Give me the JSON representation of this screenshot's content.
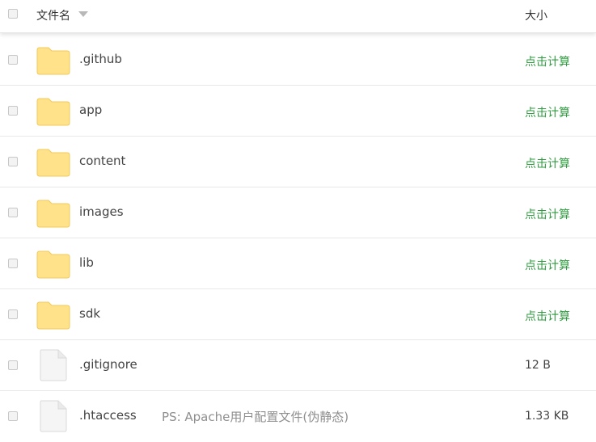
{
  "header": {
    "name_label": "文件名",
    "size_label": "大小"
  },
  "colors": {
    "folder": "#ffe28a",
    "calc_link": "#2e9c3f"
  },
  "rows": [
    {
      "name": ".github",
      "type": "folder",
      "size": "点击计算",
      "size_is_link": true
    },
    {
      "name": "app",
      "type": "folder",
      "size": "点击计算",
      "size_is_link": true
    },
    {
      "name": "content",
      "type": "folder",
      "size": "点击计算",
      "size_is_link": true
    },
    {
      "name": "images",
      "type": "folder",
      "size": "点击计算",
      "size_is_link": true
    },
    {
      "name": "lib",
      "type": "folder",
      "size": "点击计算",
      "size_is_link": true
    },
    {
      "name": "sdk",
      "type": "folder",
      "size": "点击计算",
      "size_is_link": true
    },
    {
      "name": ".gitignore",
      "type": "file",
      "size": "12 B",
      "size_is_link": false
    },
    {
      "name": ".htaccess",
      "type": "file",
      "size": "1.33 KB",
      "size_is_link": false,
      "note": "PS: Apache用户配置文件(伪静态)"
    }
  ]
}
